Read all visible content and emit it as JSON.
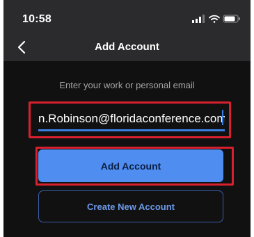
{
  "status_bar": {
    "time": "10:58",
    "icons": [
      "signal-icon",
      "wifi-icon",
      "battery-icon"
    ]
  },
  "nav": {
    "back_icon": "chevron-left-icon",
    "title": "Add Account"
  },
  "form": {
    "prompt": "Enter your work or personal email",
    "email_value": "n.Robinson@floridaconference.com",
    "add_account_label": "Add Account",
    "create_account_label": "Create New Account"
  },
  "colors": {
    "accent": "#4f8df0",
    "highlight": "#d9202e",
    "background": "#111111"
  }
}
